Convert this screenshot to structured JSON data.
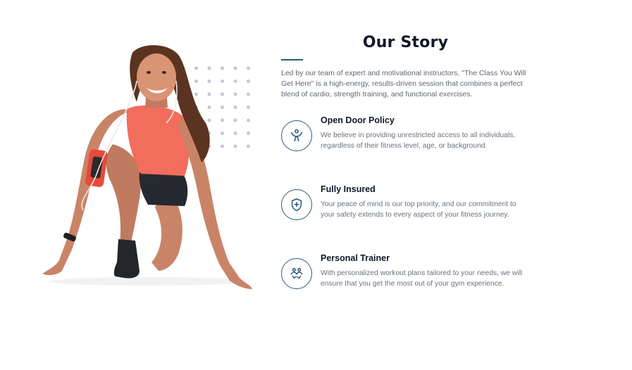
{
  "story": {
    "title": "Our Story",
    "intro": "Led by our team of expert and motivational instructors, \"The Class You Will Get Here\" is a high-energy, results-driven session that combines a perfect blend of cardio, strength training, and functional exercises."
  },
  "features": [
    {
      "title": "Open Door Policy",
      "text": "We believe in providing unrestricted access to all individuals, regardless of their fitness level, age, or background.",
      "icon": "open-arms-person-icon"
    },
    {
      "title": "Fully Insured",
      "text": "Your peace of mind is our top priority, and our commitment to your safety extends to every aspect of your fitness journey.",
      "icon": "shield-plus-icon"
    },
    {
      "title": "Personal Trainer",
      "text": "With personalized workout plans tailored to your needs, we will ensure that you get the most out of your gym experience.",
      "icon": "trainer-people-icon"
    }
  ],
  "colors": {
    "accent": "#2b5a7f",
    "heading": "#101828",
    "body_text": "#6a7180",
    "dots": "#c3c9d4"
  }
}
